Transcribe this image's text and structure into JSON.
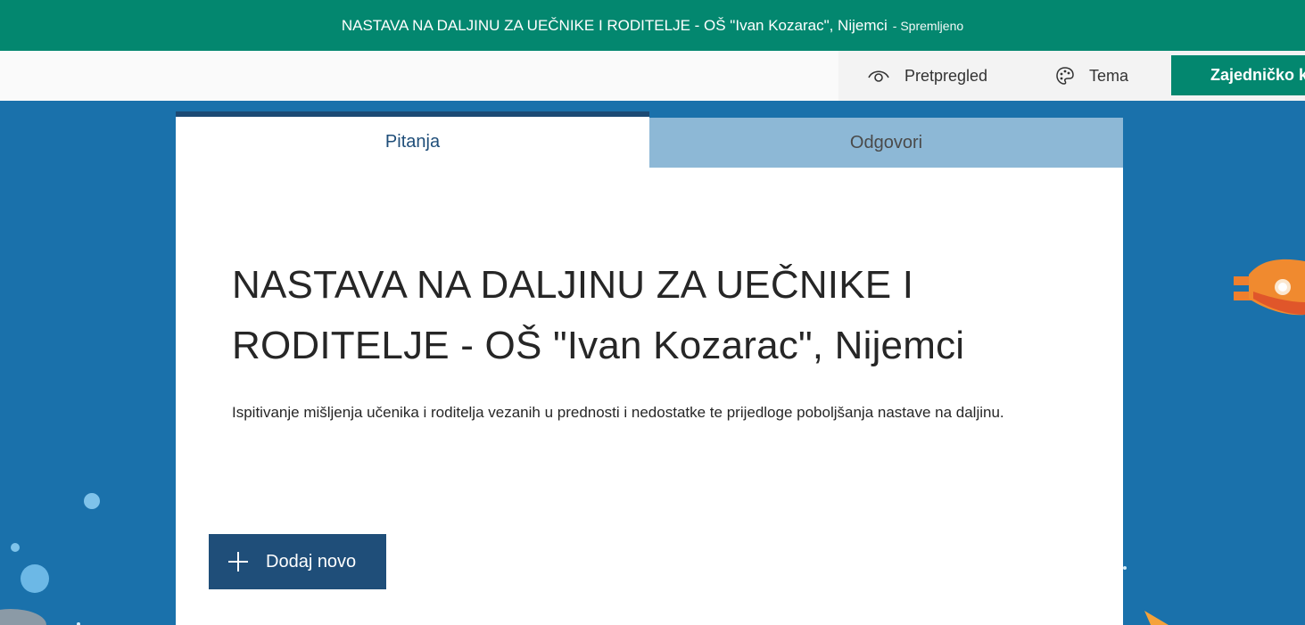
{
  "window": {
    "title": "NASTAVA NA DALJINU ZA UEČNIKE I RODITELJE - OŠ \"Ivan Kozarac\", Nijemci",
    "status": "- Spremljeno"
  },
  "toolbar": {
    "preview_label": "Pretpregled",
    "theme_label": "Tema",
    "share_label": "Zajedničko k",
    "preview_icon": "eye-icon",
    "theme_icon": "palette-icon"
  },
  "tabs": [
    {
      "label": "Pitanja",
      "active": true
    },
    {
      "label": "Odgovori",
      "active": false
    }
  ],
  "form": {
    "title": "NASTAVA NA DALJINU ZA UEČNIKE I RODITELJE - OŠ \"Ivan Kozarac\", Nijemci",
    "description": "Ispitivanje mišljenja učenika i roditelja vezanih u prednosti i nedostatke te prijedloge poboljšanja nastave na daljinu."
  },
  "add_button": {
    "label": "Dodaj novo",
    "icon": "plus-icon"
  },
  "colors": {
    "header": "#03876f",
    "background": "#1a71ab",
    "primary_button": "#1f4e79",
    "inactive_tab": "#8db8d6"
  }
}
